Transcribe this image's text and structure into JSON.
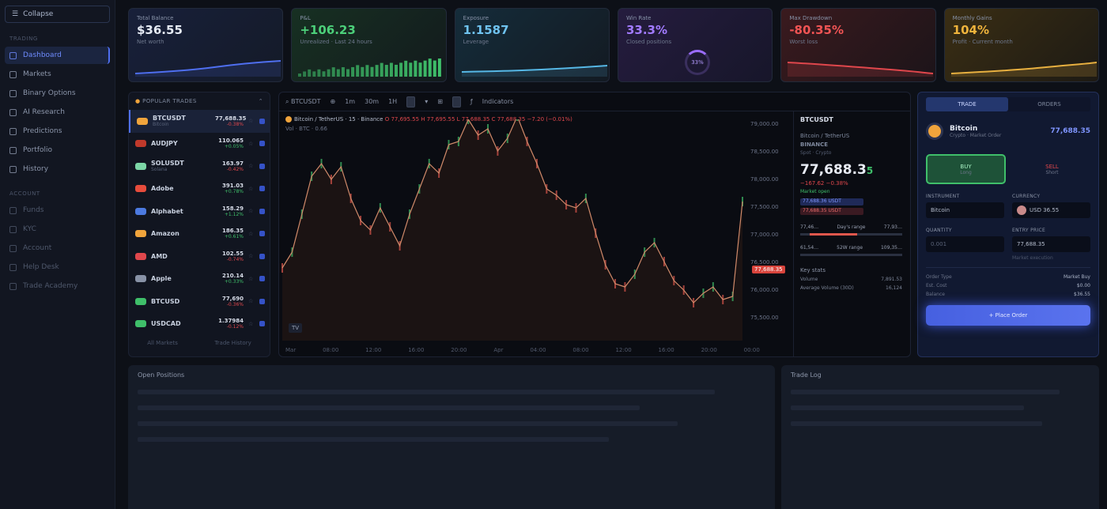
{
  "sidebar": {
    "collapse_label": "Collapse",
    "section_main": "Trading",
    "items": [
      {
        "label": "Dashboard"
      },
      {
        "label": "Markets"
      },
      {
        "label": "Binary Options"
      },
      {
        "label": "AI Research"
      },
      {
        "label": "Predictions"
      },
      {
        "label": "Portfolio"
      },
      {
        "label": "History"
      }
    ],
    "section_account": "Account",
    "account_items": [
      {
        "label": "Funds"
      },
      {
        "label": "KYC"
      },
      {
        "label": "Account"
      },
      {
        "label": "Help Desk"
      },
      {
        "label": "Trade Academy"
      }
    ]
  },
  "stats": [
    {
      "label": "Total Balance",
      "value": "$36.55",
      "sub": "Net worth"
    },
    {
      "label": "P&L",
      "value": "+106.23",
      "sub": "Unrealized · Last 24 hours"
    },
    {
      "label": "Exposure",
      "value": "1.1587",
      "sub": "Leverage"
    },
    {
      "label": "Win Rate",
      "value": "33.3%",
      "sub": "Closed positions",
      "gauge": "33%"
    },
    {
      "label": "Max Drawdown",
      "value": "-80.35%",
      "sub": "Worst loss"
    },
    {
      "label": "Monthly Gains",
      "value": "104%",
      "sub": "Profit · Current month"
    }
  ],
  "traders": {
    "header": "POPULAR TRADES",
    "rows": [
      {
        "name": "BTCUSDT",
        "sub": "Bitcoin",
        "price": "77,688.35",
        "chg": "-0.38%",
        "dir": "down",
        "color": "#f0a43c"
      },
      {
        "name": "AUDJPY",
        "sub": "",
        "price": "110.065",
        "chg": "+0.05%",
        "dir": "up",
        "color": "#c0392b"
      },
      {
        "name": "SOLUSDT",
        "sub": "Solana",
        "price": "163.97",
        "chg": "-0.42%",
        "dir": "down",
        "color": "#7cd6a6"
      },
      {
        "name": "Adobe",
        "sub": "",
        "price": "391.03",
        "chg": "+0.78%",
        "dir": "up",
        "color": "#e74c3c"
      },
      {
        "name": "Alphabet",
        "sub": "",
        "price": "158.29",
        "chg": "+1.12%",
        "dir": "up",
        "color": "#4c7ae0"
      },
      {
        "name": "Amazon",
        "sub": "",
        "price": "186.35",
        "chg": "+0.61%",
        "dir": "up",
        "color": "#f0a43c"
      },
      {
        "name": "AMD",
        "sub": "",
        "price": "102.55",
        "chg": "-0.74%",
        "dir": "down",
        "color": "#e0474c"
      },
      {
        "name": "Apple",
        "sub": "",
        "price": "210.14",
        "chg": "+0.33%",
        "dir": "up",
        "color": "#8892a6"
      },
      {
        "name": "BTCUSD",
        "sub": "",
        "price": "77,690",
        "chg": "-0.36%",
        "dir": "down",
        "color": "#3fbf6a"
      },
      {
        "name": "USDCAD",
        "sub": "",
        "price": "1.37984",
        "chg": "-0.12%",
        "dir": "down",
        "color": "#3fbf6a"
      }
    ],
    "foot_left": "All Markets",
    "foot_right": "Trade History"
  },
  "chart": {
    "symbol": "BTCUSDT",
    "interval": "1m",
    "range": "30m",
    "style": "1H",
    "toolbar_extra": "Indicators",
    "legend": "Bitcoin / TetherUS · 15 · Binance",
    "legend_ohlc": "O 77,695.55  H 77,695.55  L 77,688.35  C 77,688.35  −7.20 (−0.01%)",
    "legend_vol": "Vol · BTC · 0.66",
    "price_ticks": [
      "79,000.00",
      "78,500.00",
      "78,000.00",
      "77,500.00",
      "77,000.00",
      "76,500.00",
      "76,000.00",
      "75,500.00"
    ],
    "last_price": "77,688.35",
    "time_ticks": [
      "Mar",
      "08:00",
      "12:00",
      "16:00",
      "20:00",
      "Apr",
      "04:00",
      "08:00",
      "12:00",
      "16:00",
      "20:00",
      "00:00"
    ],
    "badge": "TV"
  },
  "chart_data": {
    "type": "line",
    "title": "",
    "xlabel": "",
    "ylabel": "",
    "ylim": [
      75500,
      79000
    ],
    "values": [
      76650,
      76900,
      77500,
      78100,
      78300,
      78050,
      78250,
      77750,
      77400,
      77250,
      77600,
      77300,
      77000,
      77500,
      77900,
      78300,
      78150,
      78600,
      78650,
      79000,
      78750,
      78850,
      78500,
      78700,
      79050,
      78650,
      78300,
      77900,
      77800,
      77650,
      77600,
      77750,
      77200,
      76700,
      76400,
      76350,
      76550,
      76900,
      77050,
      76750,
      76450,
      76300,
      76100,
      76250,
      76350,
      76150,
      76200,
      77700
    ]
  },
  "orderbook": {
    "symbol": "BTCUSDT",
    "pair": "Bitcoin / TetherUS",
    "pair2": "BINANCE",
    "exchange": "Spot · Crypto",
    "price_main": "77,688.3",
    "price_last": "5",
    "change": "−167.62  −0.38%",
    "market_status": "Market open",
    "pill_buy": "77,688.36 USDT",
    "pill_sell": "77,688.35 USDT",
    "day_low": "77,46…",
    "day_high": "77,93…",
    "day_label": "Day's range",
    "week_low": "61,54…",
    "week_high": "109,35…",
    "week_label": "52W range",
    "key_stats": "Key stats",
    "k1": "Volume",
    "v1": "7,891.53",
    "k2": "Average Volume (30D)",
    "v2": "16,124"
  },
  "trade": {
    "tab_trade": "TRADE",
    "tab_orders": "ORDERS",
    "asset_name": "Bitcoin",
    "asset_sub": "Crypto · Market Order",
    "asset_price": "77,688.35",
    "buy_label": "BUY",
    "buy_sub": "Long",
    "sell_label": "SELL",
    "sell_sub": "Short",
    "f1_label": "INSTRUMENT",
    "f1_value": "Bitcoin",
    "f2_label": "CURRENCY",
    "f2_value": "USD 36.55",
    "f3_label": "QUANTITY",
    "f3_value": "0.001",
    "f4_label": "ENTRY PRICE",
    "f4_value": "77,688.35",
    "hint": "Market execution",
    "kv": [
      {
        "k": "Order Type",
        "v": "Market Buy"
      },
      {
        "k": "Est. Cost",
        "v": "$0.00"
      },
      {
        "k": "Balance",
        "v": "$36.55"
      }
    ],
    "place_label": "Place Order"
  },
  "bottom": {
    "left_title": "Open Positions",
    "right_title": "Trade Log"
  }
}
